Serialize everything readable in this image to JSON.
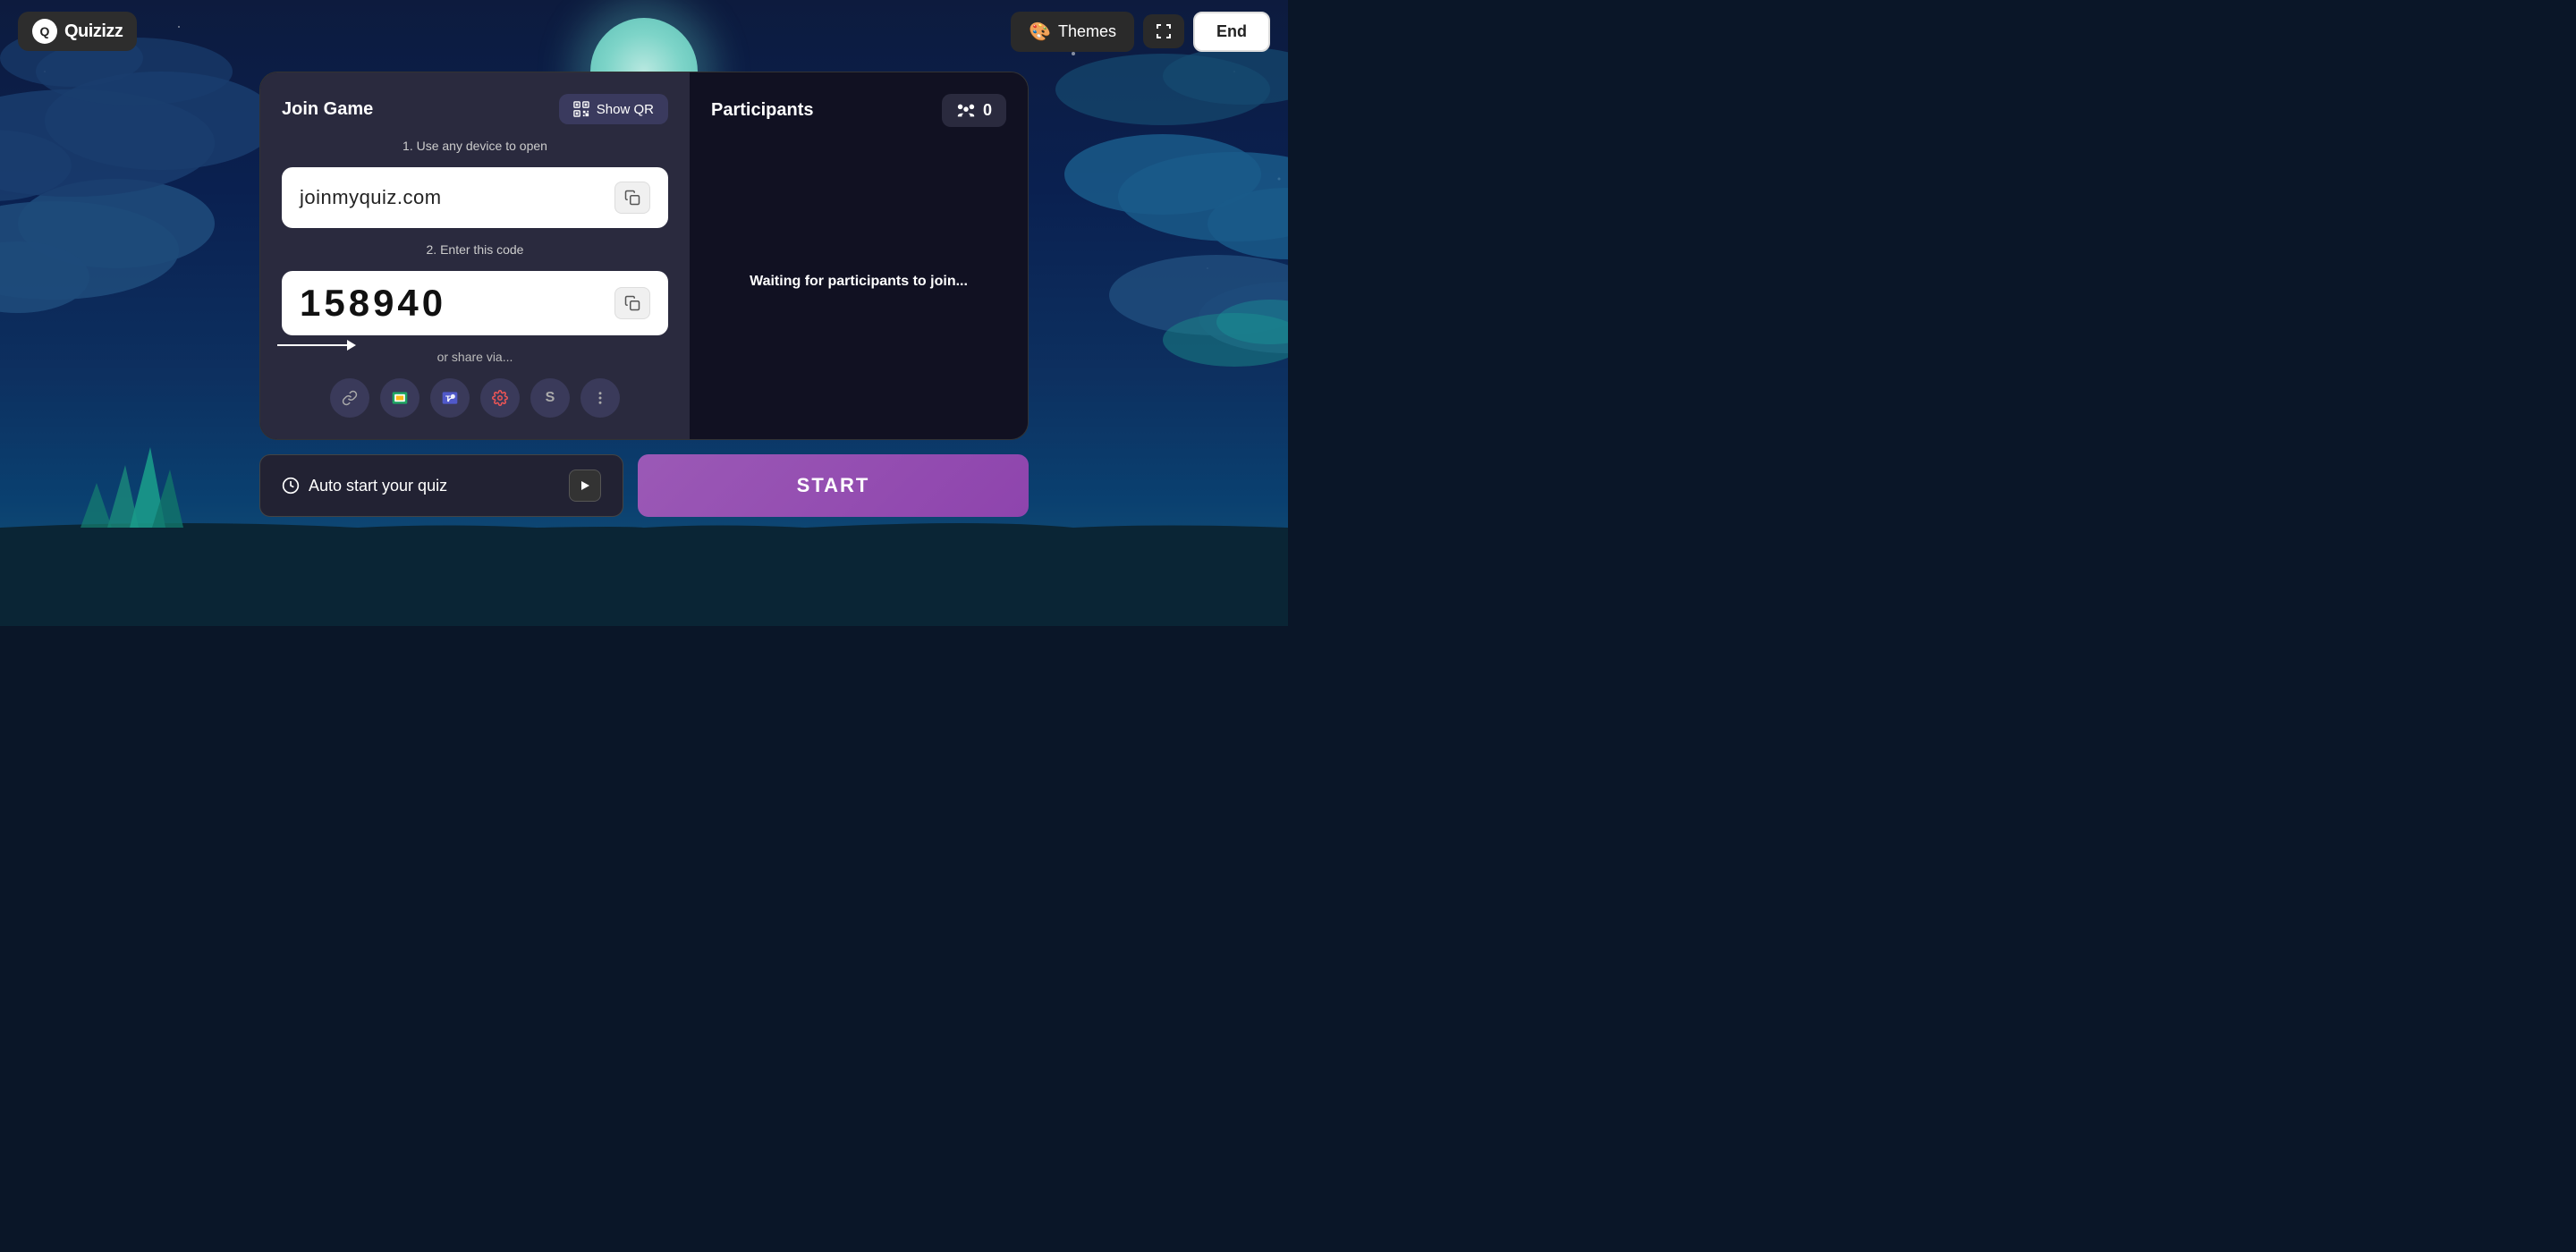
{
  "app": {
    "logo_text": "Quizizz"
  },
  "nav": {
    "themes_label": "Themes",
    "end_label": "End"
  },
  "join_panel": {
    "title": "Join Game",
    "show_qr_label": "Show QR",
    "step1_label": "1. Use any device to open",
    "url_value": "joinmyquiz.com",
    "step2_label": "2. Enter this code",
    "code_value": "158940",
    "share_label": "or share via...",
    "share_icons": [
      {
        "name": "link-icon",
        "symbol": "🔗"
      },
      {
        "name": "google-classroom-icon",
        "symbol": "📋"
      },
      {
        "name": "teams-icon",
        "symbol": "T"
      },
      {
        "name": "settings-icon",
        "symbol": "⚙"
      },
      {
        "name": "schoology-icon",
        "symbol": "S"
      },
      {
        "name": "more-icon",
        "symbol": "⋮"
      }
    ]
  },
  "participants_panel": {
    "title": "Participants",
    "count": "0",
    "waiting_text": "Waiting for participants to join..."
  },
  "bottom": {
    "auto_start_label": "Auto start your quiz",
    "start_label": "START"
  }
}
